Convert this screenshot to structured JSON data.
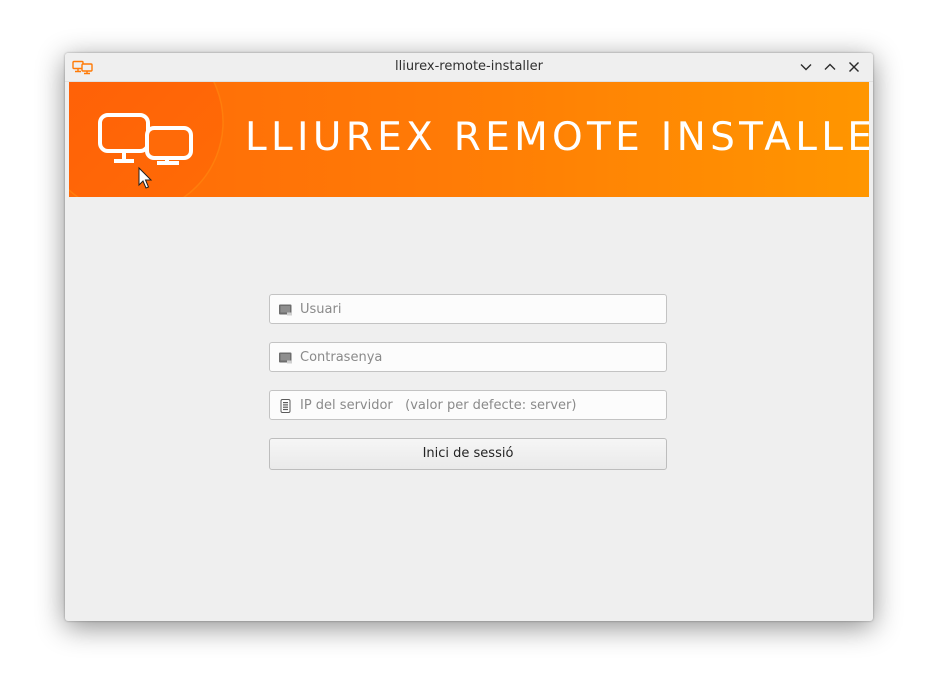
{
  "window": {
    "title": "lliurex-remote-installer"
  },
  "banner": {
    "title": "LLIUREX REMOTE INSTALLER",
    "logo_icon": "two-monitors-icon"
  },
  "form": {
    "user_placeholder": "Usuari",
    "password_placeholder": "Contrasenya",
    "server_placeholder": "IP del servidor   (valor per defecte: server)",
    "login_label": "Inici de sessió"
  },
  "colors": {
    "banner_start": "#ff6a08",
    "banner_end": "#ff9600",
    "accent": "#ff7a06"
  }
}
